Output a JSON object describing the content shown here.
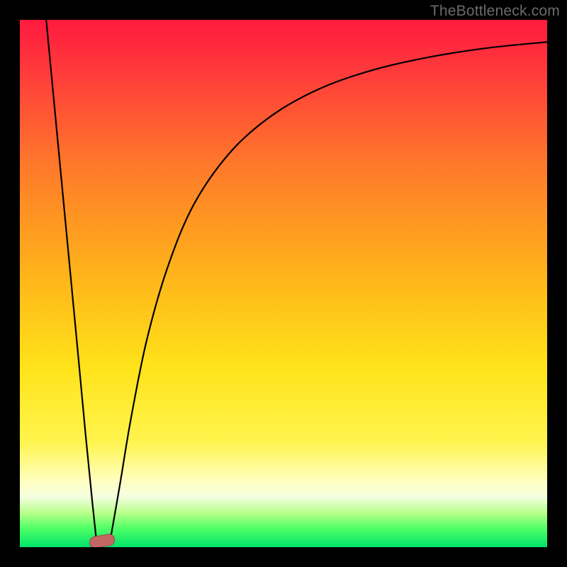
{
  "watermark": "TheBottleneck.com",
  "colors": {
    "frame": "#000000",
    "curve": "#000000",
    "marker_fill": "#c36762",
    "marker_stroke": "#9a4b47",
    "gradient_stops": [
      {
        "offset": 0.0,
        "color": "#ff1a3f"
      },
      {
        "offset": 0.1,
        "color": "#ff3b3b"
      },
      {
        "offset": 0.28,
        "color": "#ff7a2a"
      },
      {
        "offset": 0.48,
        "color": "#ffb31a"
      },
      {
        "offset": 0.66,
        "color": "#ffe31a"
      },
      {
        "offset": 0.8,
        "color": "#fff44d"
      },
      {
        "offset": 0.875,
        "color": "#ffffc0"
      },
      {
        "offset": 0.905,
        "color": "#f3ffe0"
      },
      {
        "offset": 0.935,
        "color": "#b8ff8a"
      },
      {
        "offset": 0.965,
        "color": "#4dff66"
      },
      {
        "offset": 1.0,
        "color": "#00e36b"
      }
    ]
  },
  "chart_data": {
    "type": "line",
    "title": "",
    "xlabel": "",
    "ylabel": "",
    "xlim": [
      0,
      100
    ],
    "ylim": [
      0,
      100
    ],
    "grid": false,
    "legend": false,
    "note": "Axes are unlabeled in the source image; values are read off the plotting area as percentages of width/height. The curve is a V-shaped bottleneck curve with its minimum near x≈15.",
    "series": [
      {
        "name": "left-branch",
        "x": [
          5.0,
          7.0,
          9.0,
          11.0,
          12.5,
          13.8,
          14.6
        ],
        "y": [
          100.0,
          79.0,
          58.0,
          37.0,
          21.0,
          8.0,
          0.5
        ]
      },
      {
        "name": "right-branch",
        "x": [
          17.0,
          19.0,
          21.0,
          24.0,
          28.0,
          33.0,
          40.0,
          48.0,
          57.0,
          67.0,
          78.0,
          89.0,
          100.0
        ],
        "y": [
          0.5,
          12.0,
          24.0,
          39.0,
          53.0,
          65.0,
          75.0,
          82.0,
          87.0,
          90.5,
          93.0,
          94.7,
          95.8
        ]
      }
    ],
    "marker": {
      "note": "rounded lozenge marker at the curve minimum",
      "cx": 15.6,
      "cy": 1.3,
      "rx_pct": 2.3,
      "ry_pct": 1.1
    }
  }
}
